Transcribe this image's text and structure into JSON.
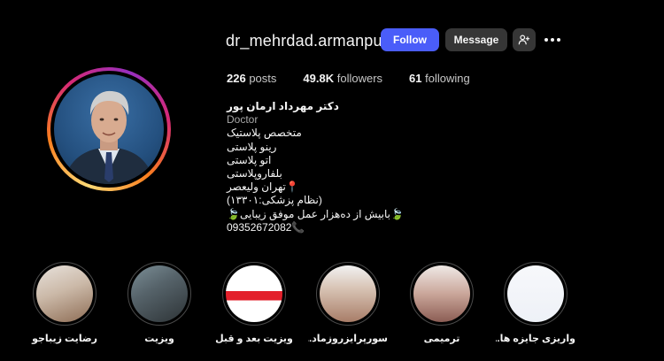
{
  "profile": {
    "username": "dr_mehrdad.armanpur",
    "buttons": {
      "follow": "Follow",
      "message": "Message"
    },
    "icons": {
      "add_user": "person-add-icon",
      "more": "more-options-icon"
    },
    "stats": {
      "posts_count": "226",
      "posts_label": "posts",
      "followers_count": "49.8K",
      "followers_label": "followers",
      "following_count": "61",
      "following_label": "following"
    },
    "bio": {
      "name": "دکتر مهرداد ارمان پور",
      "category": "Doctor",
      "lines": [
        "متخصص پلاستیک",
        "رینو پلاستی",
        "اتو پلاستی",
        "بلفاروپلاستی",
        "📍تهران ولیعصر",
        "(نظام پزشکی:۱۳۳۰۱)",
        "🍃بابیش از ده‌هزار عمل موفق زیبایی🍃",
        "09352672082📞"
      ]
    }
  },
  "highlights": [
    {
      "label": "رضایت زیباجو"
    },
    {
      "label": "ویزیت"
    },
    {
      "label": "ویزیت بعد و قبل"
    },
    {
      "label": "سورپرایزروزماد..."
    },
    {
      "label": "ترمیمی"
    },
    {
      "label": "واریزی جایزه ها..."
    }
  ],
  "colors": {
    "background": "#000000",
    "follow_button": "#4a5df9",
    "secondary_button": "#363636",
    "text": "#f5f5f5"
  }
}
